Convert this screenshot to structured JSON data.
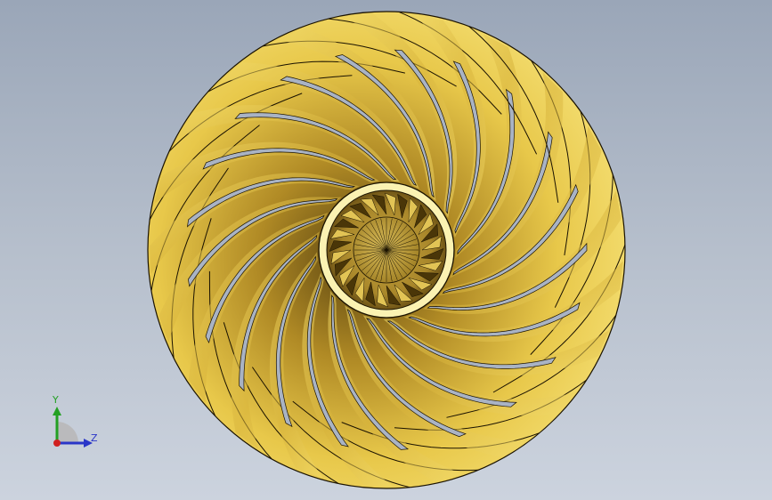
{
  "viewport": {
    "background_top": "#9aa6b8",
    "background_bottom": "#ccd3de"
  },
  "model": {
    "type": "centrifugal impeller",
    "view": "front view",
    "blade_count": 21,
    "inducer_blade_count": 28,
    "blade_color": "#e6c445",
    "edge_color": "#1a1200"
  },
  "triad": {
    "y_label": "Y",
    "z_label": "Z",
    "y_color": "#23a023",
    "z_color": "#2a36c8",
    "x_color": "#d02020"
  }
}
